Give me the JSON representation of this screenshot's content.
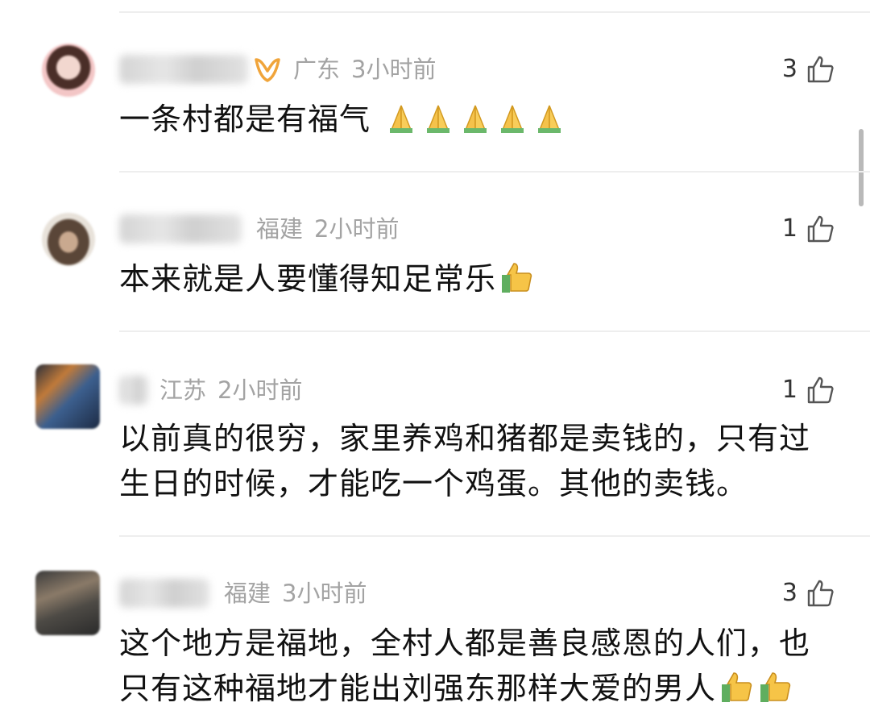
{
  "comments": [
    {
      "location": "广东",
      "time": "3小时前",
      "likes": "3",
      "text": "一条村都是有福气",
      "emoji": [
        "folded-hands",
        "folded-hands",
        "folded-hands",
        "folded-hands",
        "folded-hands"
      ],
      "vip": true
    },
    {
      "location": "福建",
      "time": "2小时前",
      "likes": "1",
      "text": "本来就是人要懂得知足常乐",
      "emoji": [
        "thumbs-up"
      ],
      "vip": false
    },
    {
      "location": "江苏",
      "time": "2小时前",
      "likes": "1",
      "text_line1": "以前真的很穷，家里养鸡和猪都是卖钱的，只有过",
      "text_line2": "生日的时候，才能吃一个鸡蛋。其他的卖钱。",
      "vip": false
    },
    {
      "location": "福建",
      "time": "3小时前",
      "likes": "3",
      "text_line1": "这个地方是福地，全村人都是善良感恩的人们，也",
      "text_line2": "只有这种福地才能出刘强东那样大爱的男人",
      "emoji": [
        "thumbs-up",
        "thumbs-up"
      ],
      "vip": false
    }
  ],
  "colors": {
    "meta": "#a3a3a3",
    "text": "#111111",
    "divider": "#eeeeee",
    "vip": "#f0a43a"
  }
}
